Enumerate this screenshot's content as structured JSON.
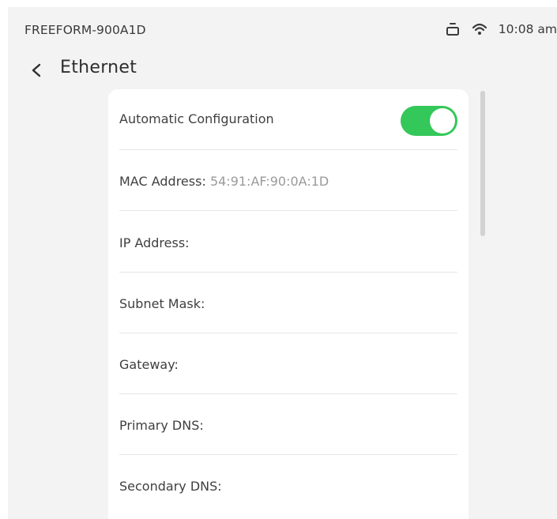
{
  "status_bar": {
    "device_name": "FREEFORM-900A1D",
    "icons": [
      "ethernet-icon",
      "wifi-icon"
    ],
    "time": "10:08 am"
  },
  "header": {
    "back_icon": "chevron-left-icon",
    "title": "Ethernet"
  },
  "settings": {
    "automatic_configuration": {
      "label": "Automatic Configuration",
      "enabled": true
    },
    "mac_address": {
      "label": "MAC Address:",
      "value": "54:91:AF:90:0A:1D"
    },
    "ip_address": {
      "label": "IP Address:",
      "value": ""
    },
    "subnet_mask": {
      "label": "Subnet Mask:",
      "value": ""
    },
    "gateway": {
      "label": "Gateway:",
      "value": ""
    },
    "primary_dns": {
      "label": "Primary DNS:",
      "value": ""
    },
    "secondary_dns": {
      "label": "Secondary DNS:",
      "value": ""
    }
  },
  "colors": {
    "toggle_on": "#34c759",
    "background": "#f3f3f3",
    "card": "#ffffff",
    "value_text": "#9a9a9a"
  }
}
